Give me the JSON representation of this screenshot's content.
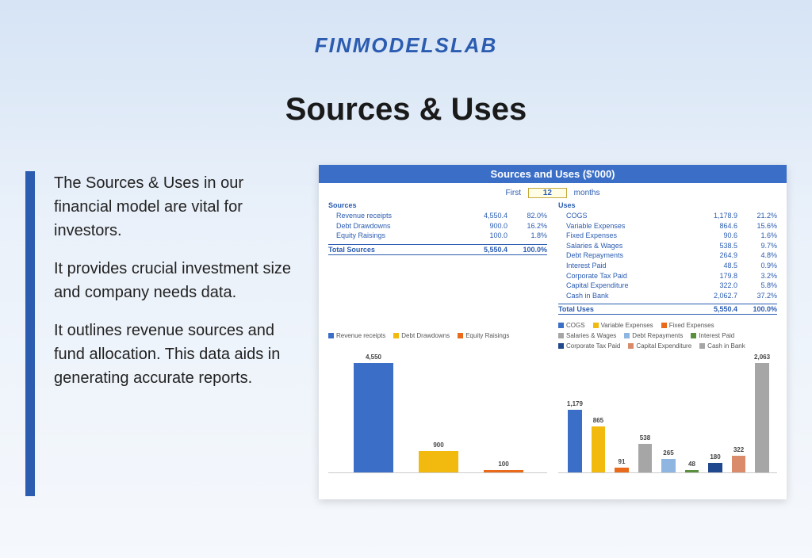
{
  "brand": "FINMODELSLAB",
  "page_title": "Sources & Uses",
  "description": {
    "p1": "The Sources & Uses in our financial model are vital for investors.",
    "p2": "It provides crucial investment size and company needs data.",
    "p3": "It outlines revenue sources and fund allocation. This data aids in generating accurate reports."
  },
  "panel": {
    "title": "Sources and Uses ($'000)",
    "period_prefix": "First",
    "period_value": "12",
    "period_suffix": "months",
    "sources_header": "Sources",
    "uses_header": "Uses",
    "sources": [
      {
        "label": "Revenue receipts",
        "value": "4,550.4",
        "pct": "82.0%"
      },
      {
        "label": "Debt Drawdowns",
        "value": "900.0",
        "pct": "16.2%"
      },
      {
        "label": "Equity Raisings",
        "value": "100.0",
        "pct": "1.8%"
      }
    ],
    "uses": [
      {
        "label": "COGS",
        "value": "1,178.9",
        "pct": "21.2%"
      },
      {
        "label": "Variable Expenses",
        "value": "864.6",
        "pct": "15.6%"
      },
      {
        "label": "Fixed Expenses",
        "value": "90.6",
        "pct": "1.6%"
      },
      {
        "label": "Salaries & Wages",
        "value": "538.5",
        "pct": "9.7%"
      },
      {
        "label": "Debt Repayments",
        "value": "264.9",
        "pct": "4.8%"
      },
      {
        "label": "Interest Paid",
        "value": "48.5",
        "pct": "0.9%"
      },
      {
        "label": "Corporate Tax Paid",
        "value": "179.8",
        "pct": "3.2%"
      },
      {
        "label": "Capital Expenditure",
        "value": "322.0",
        "pct": "5.8%"
      },
      {
        "label": "Cash in Bank",
        "value": "2,062.7",
        "pct": "37.2%"
      }
    ],
    "total_sources_label": "Total Sources",
    "total_sources_value": "5,550.4",
    "total_sources_pct": "100.0%",
    "total_uses_label": "Total Uses",
    "total_uses_value": "5,550.4",
    "total_uses_pct": "100.0%"
  },
  "colors": {
    "blue": "#3b6fc7",
    "yellow": "#f2b90f",
    "orange": "#e86a1a",
    "grey": "#a6a6a6",
    "lightblue": "#8fb6e0",
    "green": "#5a8f3d",
    "darkblue": "#20488c",
    "salmon": "#d98b6a"
  },
  "chart_data": [
    {
      "type": "bar",
      "title": "Sources",
      "categories": [
        "Revenue receipts",
        "Debt Drawdowns",
        "Equity Raisings"
      ],
      "values": [
        4550,
        900,
        100
      ],
      "labels": [
        "4,550",
        "900",
        "100"
      ],
      "colors": [
        "#3b6fc7",
        "#f2b90f",
        "#e86a1a"
      ],
      "ylim": [
        0,
        4550
      ]
    },
    {
      "type": "bar",
      "title": "Uses",
      "categories": [
        "COGS",
        "Variable Expenses",
        "Fixed Expenses",
        "Salaries & Wages",
        "Debt Repayments",
        "Interest Paid",
        "Corporate Tax Paid",
        "Capital Expenditure",
        "Cash in Bank"
      ],
      "values": [
        1179,
        865,
        91,
        538,
        265,
        48,
        180,
        322,
        2063
      ],
      "labels": [
        "1,179",
        "865",
        "91",
        "538",
        "265",
        "48",
        "180",
        "322",
        "2,063"
      ],
      "colors": [
        "#3b6fc7",
        "#f2b90f",
        "#e86a1a",
        "#a6a6a6",
        "#8fb6e0",
        "#5a8f3d",
        "#20488c",
        "#d98b6a",
        "#a6a6a6"
      ],
      "ylim": [
        0,
        2063
      ]
    }
  ]
}
